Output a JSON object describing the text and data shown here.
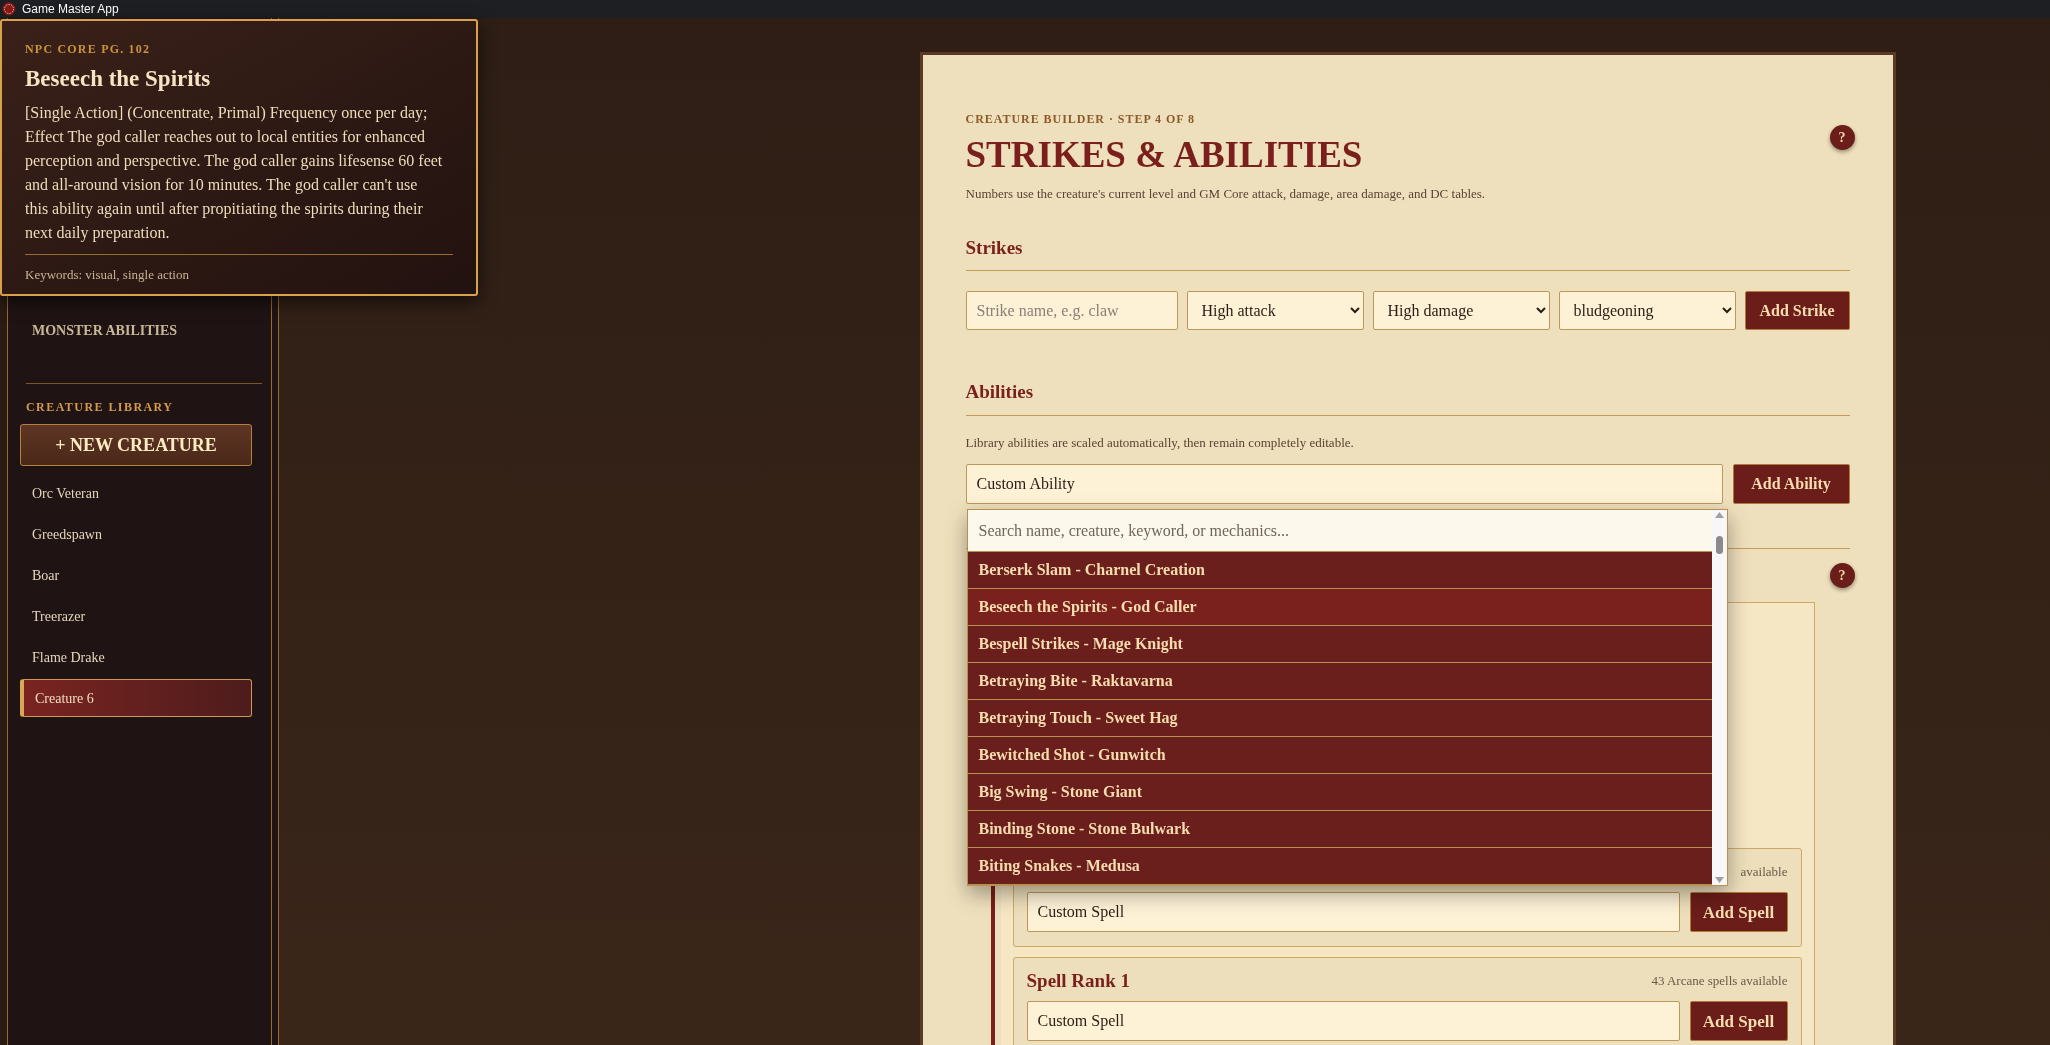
{
  "window": {
    "title": "Game Master App"
  },
  "tooltip": {
    "source": "NPC CORE PG. 102",
    "title": "Beseech the Spirits",
    "description": "[Single Action] (Concentrate, Primal) Frequency once per day; Effect The god caller reaches out to local entities for enhanced perception and perspective. The god caller gains lifesense 60 feet and all-around vision for 10 minutes. The god caller can't use this ability again until after propitiating the spirits during their next daily preparation.",
    "keywords": "Keywords: visual, single action"
  },
  "sidebar": {
    "section": "MONSTER ABILITIES",
    "library_label": "CREATURE LIBRARY",
    "new_button": "+ NEW CREATURE",
    "creatures": [
      {
        "name": "Orc Veteran",
        "selected": false
      },
      {
        "name": "Greedspawn",
        "selected": false
      },
      {
        "name": "Boar",
        "selected": false
      },
      {
        "name": "Treerazer",
        "selected": false
      },
      {
        "name": "Flame Drake",
        "selected": false
      },
      {
        "name": "Creature 6",
        "selected": true
      }
    ]
  },
  "builder": {
    "step": "CREATURE BUILDER · STEP 4 OF 8",
    "title": "STRIKES & ABILITIES",
    "help": "?",
    "subtitle": "Numbers use the creature's current level and GM Core attack, damage, area damage, and DC tables.",
    "strikes": {
      "heading": "Strikes",
      "name_placeholder": "Strike name, e.g. claw",
      "selects": [
        "High attack",
        "High damage",
        "bludgeoning"
      ],
      "button": "Add Strike"
    },
    "abilities": {
      "heading": "Abilities",
      "note": "Library abilities are scaled automatically, then remain completely editable.",
      "value": "Custom Ability",
      "button": "Add Ability",
      "dropdown": {
        "placeholder": "Search name, creature, keyword, or mechanics...",
        "options": [
          {
            "label": "Berserk Slam - Charnel Creation",
            "selected": false
          },
          {
            "label": "Beseech the Spirits - God Caller",
            "selected": true
          },
          {
            "label": "Bespell Strikes - Mage Knight",
            "selected": false
          },
          {
            "label": "Betraying Bite - Raktavarna",
            "selected": false
          },
          {
            "label": "Betraying Touch - Sweet Hag",
            "selected": false
          },
          {
            "label": "Bewitched Shot - Gunwitch",
            "selected": false
          },
          {
            "label": "Big Swing - Stone Giant",
            "selected": false
          },
          {
            "label": "Binding Stone - Stone Bulwark",
            "selected": false
          },
          {
            "label": "Biting Snakes - Medusa",
            "selected": false
          }
        ]
      }
    },
    "section_help": "?",
    "spell_ranks": [
      {
        "availability": "available",
        "value": "Custom Spell",
        "button": "Add Spell"
      },
      {
        "title": "Spell Rank 1",
        "availability": "43 Arcane spells available",
        "value": "Custom Spell",
        "button": "Add Spell"
      }
    ]
  }
}
